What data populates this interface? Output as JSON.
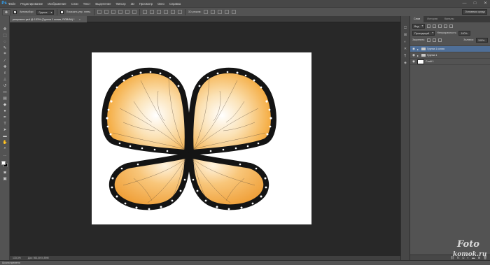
{
  "app": {
    "logo": "Ps"
  },
  "menu": [
    "Файл",
    "Редактирование",
    "Изображение",
    "Слои",
    "Текст",
    "Выделение",
    "Фильтр",
    "3D",
    "Просмотр",
    "Окно",
    "Справка"
  ],
  "window_controls": [
    "—",
    "□",
    "✕"
  ],
  "options": {
    "tool_glyph": "✥",
    "auto_select_label": "Автовыбор:",
    "auto_select_value": "Группа",
    "show_controls_label": "Показать упр. элем.",
    "mode3d_label": "3D-режим:",
    "workspace": "Основная среда"
  },
  "document": {
    "tab_title": "репрезент.psd @ 133% (Группа 1 копия, RGB/8#) *",
    "close": "×"
  },
  "status": {
    "zoom": "133,3%",
    "doc_size": "Док: 561,6K/4,59M",
    "timeline": "Шкала времени"
  },
  "panel": {
    "tabs": [
      "Слои",
      "История",
      "Каналы"
    ],
    "kind_filter": "Вид",
    "blend_mode": "Проходящий",
    "opacity_label": "Непрозрачность:",
    "opacity_value": "100%",
    "lock_label": "Закрепить:",
    "fill_label": "Заливка:",
    "fill_value": "100%",
    "layers": [
      {
        "name": "Группа 1 копия",
        "kind": "group",
        "selected": true
      },
      {
        "name": "Группа 1",
        "kind": "group",
        "selected": false
      },
      {
        "name": "Слой 1",
        "kind": "layer",
        "selected": false
      }
    ]
  },
  "watermark": {
    "line1": "Foto",
    "line2": "komok.ru"
  },
  "colors": {
    "accent_selected_layer": "#4f6f98",
    "ps_blue": "#31a8ff",
    "wing_orange": "#f5a93a",
    "wing_border": "#141414"
  }
}
